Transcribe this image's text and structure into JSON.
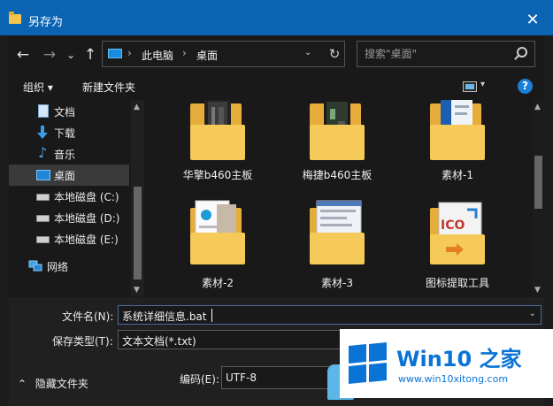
{
  "window": {
    "title": "另存为",
    "close_glyph": "✕"
  },
  "nav": {
    "back": "←",
    "forward": "→",
    "recent": "⌄",
    "up": "↑",
    "breadcrumbs": [
      "此电脑",
      "桌面"
    ],
    "separator": "›",
    "dropdown": "⌄",
    "refresh": "↻"
  },
  "search": {
    "placeholder": "搜索\"桌面\""
  },
  "toolbar": {
    "organize": "组织 ▾",
    "new_folder": "新建文件夹",
    "help": "?",
    "view_dropdown": "▾"
  },
  "sidebar": {
    "items": [
      {
        "label": "文档",
        "icon": "document-icon"
      },
      {
        "label": "下载",
        "icon": "download-icon"
      },
      {
        "label": "音乐",
        "icon": "music-icon"
      },
      {
        "label": "桌面",
        "icon": "desktop-icon",
        "selected": true
      },
      {
        "label": "本地磁盘 (C:)",
        "icon": "drive-icon"
      },
      {
        "label": "本地磁盘 (D:)",
        "icon": "drive-icon"
      },
      {
        "label": "本地磁盘 (E:)",
        "icon": "drive-icon"
      },
      {
        "label": "网络",
        "icon": "network-icon"
      }
    ]
  },
  "files": [
    {
      "name": "华擎b460主板",
      "type": "folder"
    },
    {
      "name": "梅捷b460主板",
      "type": "folder"
    },
    {
      "name": "素材-1",
      "type": "folder"
    },
    {
      "name": "素材-2",
      "type": "folder"
    },
    {
      "name": "素材-3",
      "type": "folder"
    },
    {
      "name": "图标提取工具",
      "type": "folder"
    }
  ],
  "form": {
    "filename_label": "文件名(N):",
    "filename_value": "系统详细信息.bat",
    "filetype_label": "保存类型(T):",
    "filetype_value": "文本文档(*.txt)",
    "encoding_label": "编码(E):",
    "encoding_value": "UTF-8",
    "hide_folders": "隐藏文件夹"
  },
  "watermark": {
    "brand": "Win10 之家",
    "url": "www.win10xitong.com"
  },
  "colors": {
    "titlebar": "#0a63b3",
    "accent": "#1a7fd6",
    "folder": "#f4c44e"
  }
}
